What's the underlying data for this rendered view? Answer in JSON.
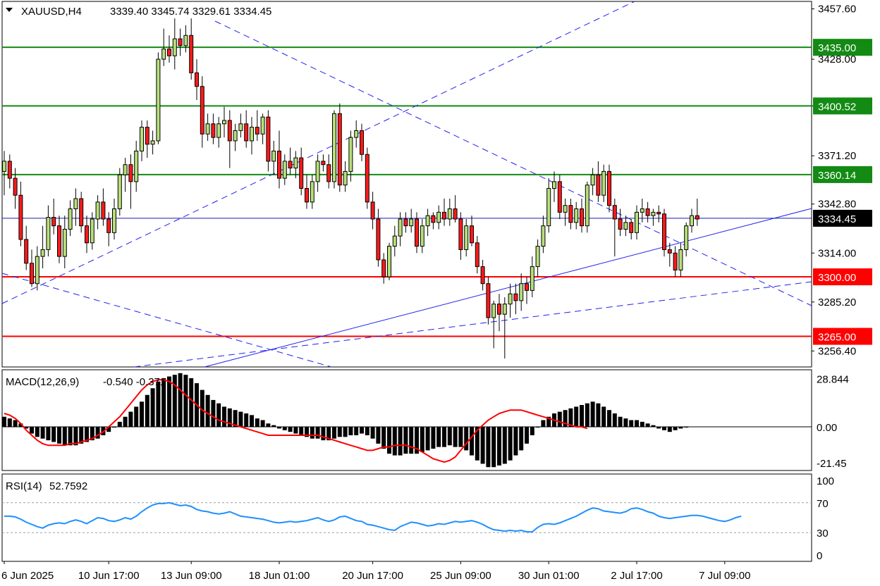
{
  "header": {
    "symbol": "XAUUSD,H4",
    "ohlc": "3339.40 3345.74 3329.61 3334.45"
  },
  "colors": {
    "bull_fill": "#b8e07a",
    "bear_fill": "#ff1a1a",
    "candle_outline": "#000000",
    "resistance_line": "#138a13",
    "support_line": "#ff0000",
    "trend_line": "#2222ee",
    "price_line": "#1c1cb0",
    "macd_hist": "#000000",
    "macd_signal": "#ff0000",
    "rsi_line": "#1e90ff",
    "rsi_levels": "#a0a0a0"
  },
  "chart_data": [
    {
      "type": "candlestick",
      "panel": "price",
      "price_scale": [
        "3457.60",
        "3428.00",
        "3400.52",
        "3371.20",
        "3342.80",
        "3314.00",
        "3285.20",
        "3256.40"
      ],
      "current_price": {
        "label": "3334.45",
        "value": 3334.45
      },
      "horizontal_levels": [
        {
          "label": "3435.00",
          "value": 3435.0,
          "kind": "resistance"
        },
        {
          "label": "3400.52",
          "value": 3400.52,
          "kind": "resistance"
        },
        {
          "label": "3360.14",
          "value": 3360.14,
          "kind": "resistance"
        },
        {
          "label": "3300.00",
          "value": 3300.0,
          "kind": "support"
        },
        {
          "label": "3265.00",
          "value": 3265.0,
          "kind": "support"
        }
      ],
      "x_labels": [
        "6 Jun 2025",
        "10 Jun 17:00",
        "13 Jun 09:00",
        "18 Jun 01:00",
        "20 Jun 17:00",
        "25 Jun 09:00",
        "30 Jun 01:00",
        "2 Jul 17:00",
        "7 Jul 09:00"
      ],
      "x_label_bar_index": [
        0,
        19,
        34,
        50,
        67,
        83,
        99,
        115,
        131
      ],
      "ylim": [
        3247,
        3462
      ],
      "candles": [
        [
          3362,
          3374,
          3348,
          3368
        ],
        [
          3368,
          3372,
          3352,
          3358
        ],
        [
          3358,
          3364,
          3340,
          3348
        ],
        [
          3348,
          3356,
          3318,
          3322
        ],
        [
          3322,
          3330,
          3304,
          3308
        ],
        [
          3308,
          3316,
          3294,
          3296
        ],
        [
          3296,
          3318,
          3292,
          3312
        ],
        [
          3312,
          3330,
          3305,
          3316
        ],
        [
          3316,
          3342,
          3312,
          3335
        ],
        [
          3335,
          3346,
          3325,
          3330
        ],
        [
          3330,
          3336,
          3308,
          3312
        ],
        [
          3312,
          3336,
          3305,
          3328
        ],
        [
          3328,
          3345,
          3324,
          3340
        ],
        [
          3340,
          3352,
          3330,
          3346
        ],
        [
          3346,
          3350,
          3326,
          3330
        ],
        [
          3330,
          3336,
          3314,
          3320
        ],
        [
          3320,
          3338,
          3316,
          3334
        ],
        [
          3334,
          3348,
          3328,
          3344
        ],
        [
          3344,
          3352,
          3330,
          3334
        ],
        [
          3334,
          3338,
          3318,
          3326
        ],
        [
          3326,
          3346,
          3322,
          3340
        ],
        [
          3340,
          3364,
          3336,
          3360
        ],
        [
          3360,
          3370,
          3350,
          3366
        ],
        [
          3366,
          3372,
          3340,
          3356
        ],
        [
          3356,
          3380,
          3350,
          3374
        ],
        [
          3374,
          3392,
          3368,
          3388
        ],
        [
          3388,
          3392,
          3370,
          3378
        ],
        [
          3378,
          3386,
          3372,
          3380
        ],
        [
          3380,
          3432,
          3378,
          3428
        ],
        [
          3428,
          3446,
          3424,
          3434
        ],
        [
          3434,
          3442,
          3426,
          3430
        ],
        [
          3430,
          3452,
          3422,
          3440
        ],
        [
          3440,
          3446,
          3430,
          3436
        ],
        [
          3436,
          3448,
          3432,
          3442
        ],
        [
          3442,
          3452,
          3416,
          3420
        ],
        [
          3420,
          3428,
          3404,
          3412
        ],
        [
          3412,
          3418,
          3376,
          3384
        ],
        [
          3384,
          3396,
          3380,
          3390
        ],
        [
          3390,
          3396,
          3378,
          3382
        ],
        [
          3382,
          3394,
          3376,
          3390
        ],
        [
          3390,
          3400,
          3382,
          3392
        ],
        [
          3392,
          3398,
          3364,
          3380
        ],
        [
          3380,
          3390,
          3374,
          3386
        ],
        [
          3386,
          3396,
          3382,
          3390
        ],
        [
          3390,
          3398,
          3376,
          3380
        ],
        [
          3380,
          3394,
          3372,
          3388
        ],
        [
          3388,
          3398,
          3380,
          3384
        ],
        [
          3384,
          3396,
          3378,
          3394
        ],
        [
          3394,
          3398,
          3362,
          3368
        ],
        [
          3368,
          3380,
          3360,
          3374
        ],
        [
          3374,
          3386,
          3352,
          3358
        ],
        [
          3358,
          3372,
          3354,
          3368
        ],
        [
          3368,
          3376,
          3360,
          3364
        ],
        [
          3364,
          3374,
          3358,
          3370
        ],
        [
          3370,
          3376,
          3348,
          3352
        ],
        [
          3352,
          3360,
          3340,
          3344
        ],
        [
          3344,
          3360,
          3340,
          3356
        ],
        [
          3356,
          3372,
          3350,
          3368
        ],
        [
          3368,
          3372,
          3362,
          3366
        ],
        [
          3366,
          3372,
          3352,
          3356
        ],
        [
          3356,
          3398,
          3352,
          3396
        ],
        [
          3396,
          3402,
          3350,
          3354
        ],
        [
          3354,
          3368,
          3350,
          3362
        ],
        [
          3362,
          3386,
          3356,
          3382
        ],
        [
          3382,
          3392,
          3376,
          3386
        ],
        [
          3386,
          3390,
          3368,
          3372
        ],
        [
          3372,
          3376,
          3340,
          3344
        ],
        [
          3344,
          3350,
          3328,
          3334
        ],
        [
          3334,
          3340,
          3306,
          3310
        ],
        [
          3310,
          3314,
          3296,
          3300
        ],
        [
          3300,
          3320,
          3298,
          3318
        ],
        [
          3318,
          3330,
          3312,
          3324
        ],
        [
          3324,
          3338,
          3318,
          3334
        ],
        [
          3334,
          3338,
          3326,
          3330
        ],
        [
          3330,
          3340,
          3326,
          3334
        ],
        [
          3334,
          3338,
          3314,
          3318
        ],
        [
          3318,
          3334,
          3314,
          3330
        ],
        [
          3330,
          3340,
          3324,
          3336
        ],
        [
          3336,
          3338,
          3328,
          3332
        ],
        [
          3332,
          3342,
          3328,
          3338
        ],
        [
          3338,
          3346,
          3330,
          3334
        ],
        [
          3334,
          3346,
          3330,
          3340
        ],
        [
          3340,
          3348,
          3332,
          3334
        ],
        [
          3334,
          3338,
          3310,
          3316
        ],
        [
          3316,
          3334,
          3312,
          3330
        ],
        [
          3330,
          3336,
          3318,
          3320
        ],
        [
          3320,
          3324,
          3302,
          3306
        ],
        [
          3306,
          3310,
          3292,
          3296
        ],
        [
          3296,
          3300,
          3272,
          3276
        ],
        [
          3276,
          3286,
          3258,
          3284
        ],
        [
          3284,
          3290,
          3268,
          3278
        ],
        [
          3278,
          3288,
          3252,
          3284
        ],
        [
          3284,
          3296,
          3276,
          3290
        ],
        [
          3290,
          3296,
          3278,
          3286
        ],
        [
          3286,
          3302,
          3280,
          3296
        ],
        [
          3296,
          3300,
          3284,
          3292
        ],
        [
          3292,
          3312,
          3288,
          3306
        ],
        [
          3306,
          3322,
          3300,
          3318
        ],
        [
          3318,
          3336,
          3314,
          3330
        ],
        [
          3330,
          3358,
          3326,
          3352
        ],
        [
          3352,
          3362,
          3344,
          3356
        ],
        [
          3356,
          3360,
          3334,
          3338
        ],
        [
          3338,
          3346,
          3330,
          3342
        ],
        [
          3342,
          3346,
          3328,
          3332
        ],
        [
          3332,
          3344,
          3328,
          3340
        ],
        [
          3340,
          3346,
          3326,
          3330
        ],
        [
          3330,
          3356,
          3326,
          3354
        ],
        [
          3354,
          3364,
          3348,
          3360
        ],
        [
          3360,
          3368,
          3344,
          3348
        ],
        [
          3348,
          3366,
          3344,
          3362
        ],
        [
          3362,
          3366,
          3338,
          3342
        ],
        [
          3342,
          3346,
          3312,
          3334
        ],
        [
          3334,
          3340,
          3324,
          3328
        ],
        [
          3328,
          3336,
          3324,
          3332
        ],
        [
          3332,
          3334,
          3322,
          3326
        ],
        [
          3326,
          3342,
          3322,
          3338
        ],
        [
          3338,
          3346,
          3332,
          3340
        ],
        [
          3340,
          3344,
          3332,
          3336
        ],
        [
          3336,
          3340,
          3330,
          3338
        ],
        [
          3338,
          3342,
          3332,
          3337
        ],
        [
          3337,
          3340,
          3312,
          3316
        ],
        [
          3316,
          3320,
          3306,
          3314
        ],
        [
          3314,
          3318,
          3300,
          3304
        ],
        [
          3304,
          3320,
          3300,
          3316
        ],
        [
          3316,
          3332,
          3312,
          3330
        ],
        [
          3330,
          3340,
          3326,
          3336
        ],
        [
          3336,
          3346,
          3330,
          3334
        ]
      ]
    },
    {
      "type": "histogram+line",
      "panel": "macd",
      "name": "MACD(12,26,9)",
      "values_text": "-0.540 -0.371",
      "scale_labels": [
        "28.844",
        "0.00",
        "-21.45"
      ],
      "ylim": [
        -26,
        34
      ],
      "histogram": [
        6,
        5,
        4,
        2,
        -1,
        -4,
        -6,
        -7,
        -8,
        -9,
        -10,
        -11,
        -11,
        -11,
        -10,
        -9,
        -8,
        -7,
        -5,
        -3,
        0,
        3,
        6,
        9,
        12,
        15,
        19,
        23,
        27,
        29,
        30,
        31,
        32,
        31,
        29,
        26,
        22,
        19,
        16,
        14,
        12,
        11,
        10,
        9,
        8,
        7,
        5,
        4,
        2,
        1,
        -1,
        -2,
        -3,
        -4,
        -5,
        -6,
        -7,
        -7,
        -8,
        -8,
        -7,
        -6,
        -6,
        -5,
        -5,
        -4,
        -5,
        -7,
        -10,
        -13,
        -16,
        -17,
        -17,
        -16,
        -16,
        -16,
        -15,
        -14,
        -13,
        -12,
        -12,
        -11,
        -12,
        -12,
        -14,
        -17,
        -20,
        -22,
        -24,
        -24,
        -23,
        -22,
        -20,
        -17,
        -14,
        -10,
        -5,
        0,
        4,
        6,
        8,
        9,
        10,
        11,
        12,
        13,
        14,
        15,
        14,
        12,
        10,
        8,
        6,
        5,
        4,
        4,
        3,
        2,
        1,
        -1,
        -2,
        -3,
        -2,
        -1,
        0
      ],
      "signal": [
        8,
        7,
        5,
        2,
        -2,
        -5,
        -8,
        -10,
        -11,
        -11,
        -11,
        -11,
        -10,
        -10,
        -9,
        -8,
        -7,
        -5,
        -3,
        0,
        3,
        6,
        10,
        14,
        18,
        22,
        25,
        27,
        28,
        28,
        27,
        25,
        22,
        19,
        16,
        13,
        10,
        8,
        6,
        4,
        3,
        2,
        1,
        0,
        -1,
        -2,
        -3,
        -4,
        -5,
        -5,
        -5,
        -5,
        -5,
        -5,
        -5,
        -5,
        -5,
        -5,
        -6,
        -7,
        -8,
        -9,
        -10,
        -11,
        -12,
        -13,
        -14,
        -14,
        -13,
        -12,
        -12,
        -11,
        -11,
        -11,
        -12,
        -13,
        -15,
        -17,
        -19,
        -20,
        -21,
        -20,
        -18,
        -14,
        -10,
        -6,
        -2,
        1,
        4,
        6,
        8,
        9,
        10,
        10,
        10,
        9,
        8,
        7,
        6,
        5,
        4,
        3,
        2,
        1,
        0,
        0,
        -1
      ]
    },
    {
      "type": "line",
      "panel": "rsi",
      "name": "RSI(14)",
      "value_text": "52.7592",
      "scale_labels": [
        "100",
        "70",
        "30",
        "0"
      ],
      "levels": [
        70,
        30
      ],
      "ylim": [
        0,
        100
      ],
      "values": [
        52,
        52,
        51,
        48,
        44,
        41,
        38,
        36,
        40,
        42,
        43,
        42,
        45,
        47,
        45,
        42,
        46,
        50,
        49,
        46,
        45,
        47,
        50,
        48,
        52,
        58,
        63,
        67,
        69,
        69,
        70,
        68,
        66,
        67,
        65,
        61,
        59,
        58,
        56,
        55,
        56,
        58,
        55,
        52,
        51,
        50,
        49,
        48,
        46,
        44,
        43,
        44,
        45,
        44,
        45,
        46,
        48,
        50,
        47,
        45,
        47,
        51,
        52,
        49,
        46,
        45,
        41,
        40,
        38,
        36,
        34,
        33,
        38,
        41,
        44,
        43,
        41,
        39,
        40,
        42,
        41,
        43,
        45,
        44,
        45,
        46,
        44,
        41,
        37,
        34,
        33,
        32,
        33,
        32,
        33,
        31,
        31,
        37,
        41,
        42,
        41,
        43,
        46,
        49,
        52,
        56,
        60,
        63,
        62,
        59,
        58,
        57,
        56,
        58,
        62,
        63,
        61,
        58,
        56,
        52,
        50,
        49,
        50,
        51,
        52,
        53,
        53,
        52,
        50,
        48,
        46,
        45,
        47,
        50,
        52
      ]
    }
  ]
}
